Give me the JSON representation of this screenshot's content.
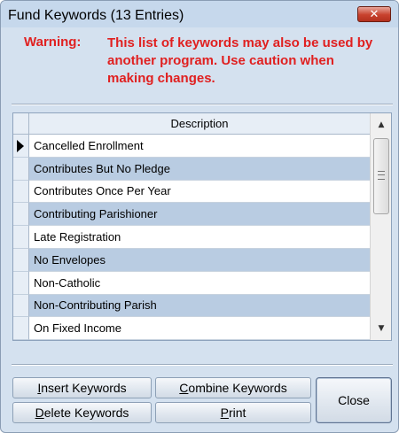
{
  "window": {
    "title": "Fund Keywords (13 Entries)",
    "close_glyph": "✕"
  },
  "warning": {
    "label": "Warning:",
    "text": "This list of keywords may also be used by another program. Use caution when making changes."
  },
  "grid": {
    "column_header": "Description",
    "current_row_indicator": "arrow-right",
    "rows": [
      "Cancelled Enrollment",
      "Contributes But No Pledge",
      "Contributes Once Per Year",
      "Contributing Parishioner",
      "Late Registration",
      "No Envelopes",
      "Non-Catholic",
      "Non-Contributing Parish",
      "On Fixed Income"
    ],
    "scroll_up_glyph": "▲",
    "scroll_down_glyph": "▼"
  },
  "buttons": {
    "insert": {
      "mnemonic": "I",
      "rest": "nsert Keywords"
    },
    "combine": {
      "mnemonic": "C",
      "rest": "ombine Keywords"
    },
    "delete": {
      "mnemonic": "D",
      "rest": "elete Keywords"
    },
    "print": {
      "mnemonic": "P",
      "rest": "rint"
    },
    "close": "Close"
  },
  "colors": {
    "warning": "#e02020",
    "row_alt": "#b9cce2",
    "window_bg": "#d4e1ef"
  }
}
